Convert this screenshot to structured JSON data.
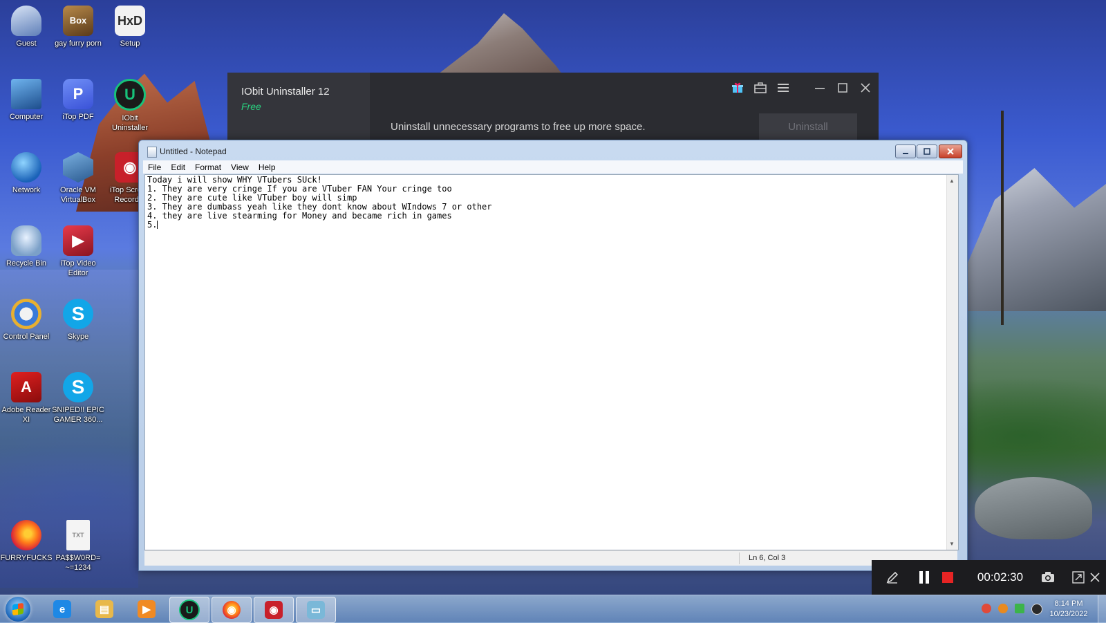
{
  "desktop": {
    "icons": [
      {
        "label": "Guest",
        "icon": "user-folder-icon",
        "glyph": ""
      },
      {
        "label": "gay furry porn",
        "icon": "box-game-icon",
        "glyph": "Box"
      },
      {
        "label": "Setup",
        "icon": "hxd-setup-icon",
        "glyph": "HxD"
      },
      {
        "label": "Computer",
        "icon": "computer-icon",
        "glyph": ""
      },
      {
        "label": "iTop PDF",
        "icon": "itop-pdf-icon",
        "glyph": "P"
      },
      {
        "label": "IObit Uninstaller",
        "icon": "iobit-uninstaller-icon",
        "glyph": "U"
      },
      {
        "label": "Network",
        "icon": "network-icon",
        "glyph": ""
      },
      {
        "label": "Oracle VM VirtualBox",
        "icon": "virtualbox-icon",
        "glyph": ""
      },
      {
        "label": "iTop Screen Recorder",
        "icon": "screen-recorder-icon",
        "glyph": "◉"
      },
      {
        "label": "Recycle Bin",
        "icon": "recycle-bin-icon",
        "glyph": ""
      },
      {
        "label": "iTop Video Editor",
        "icon": "video-editor-icon",
        "glyph": "▶"
      },
      {
        "label": "Control Panel",
        "icon": "control-panel-icon",
        "glyph": ""
      },
      {
        "label": "Skype",
        "icon": "skype-icon",
        "glyph": "S"
      },
      {
        "label": "Adobe Reader XI",
        "icon": "adobe-reader-icon",
        "glyph": "A"
      },
      {
        "label": "SNIPED!! EPIC GAMER 360...",
        "icon": "skype-shortcut-icon",
        "glyph": "S"
      },
      {
        "label": "FURRYFUCKS",
        "icon": "firefox-icon",
        "glyph": ""
      },
      {
        "label": "PA$$W0RD= ~=1234",
        "icon": "text-file-icon",
        "glyph": "TXT"
      }
    ]
  },
  "iobit": {
    "title": "IObit Uninstaller 12",
    "edition": "Free",
    "message": "Uninstall unnecessary programs to free up more space.",
    "uninstall_label": "Uninstall",
    "controls": [
      "gift-icon",
      "toolbox-icon",
      "menu-icon",
      "minimize-icon",
      "maximize-icon",
      "close-icon"
    ]
  },
  "notepad": {
    "title": "Untitled - Notepad",
    "menu": [
      "File",
      "Edit",
      "Format",
      "View",
      "Help"
    ],
    "lines": [
      "Today i will show WHY VTubers SUck!",
      "1. They are very cringe If you are VTuber FAN Your cringe too",
      "2. They are cute like VTuber boy will simp",
      "3. They are dumbass yeah like they dont know about WIndows 7 or other",
      "4. they are live stearming for Money and became rich in games",
      "5."
    ],
    "status": "Ln 6, Col 3"
  },
  "recorder": {
    "timer": "00:02:30"
  },
  "taskbar": {
    "apps": [
      {
        "name": "internet-explorer",
        "icon": "internet-explorer-icon",
        "glyph": "e",
        "color": "#1e88e5",
        "active": false
      },
      {
        "name": "file-explorer",
        "icon": "folder-icon",
        "glyph": "▤",
        "color": "#e8b84a",
        "active": false
      },
      {
        "name": "media-player",
        "icon": "media-player-icon",
        "glyph": "▶",
        "color": "#f08a24",
        "active": false
      },
      {
        "name": "iobit-uninstaller",
        "icon": "iobit-uninstaller-icon",
        "glyph": "U",
        "color": "#17c27a",
        "active": true
      },
      {
        "name": "firefox",
        "icon": "firefox-icon",
        "glyph": "◉",
        "color": "#ff7a1a",
        "active": true
      },
      {
        "name": "screen-recorder",
        "icon": "screen-recorder-icon",
        "glyph": "◉",
        "color": "#c8202a",
        "active": true
      },
      {
        "name": "notepad",
        "icon": "notepad-icon",
        "glyph": "▭",
        "color": "#7ab8d8",
        "active": true
      }
    ],
    "tray": [
      "recorder-tray-icon",
      "search-tray-icon",
      "network-tray-icon",
      "volume-tray-icon"
    ],
    "time": "8:14 PM",
    "date": "10/23/2022"
  }
}
